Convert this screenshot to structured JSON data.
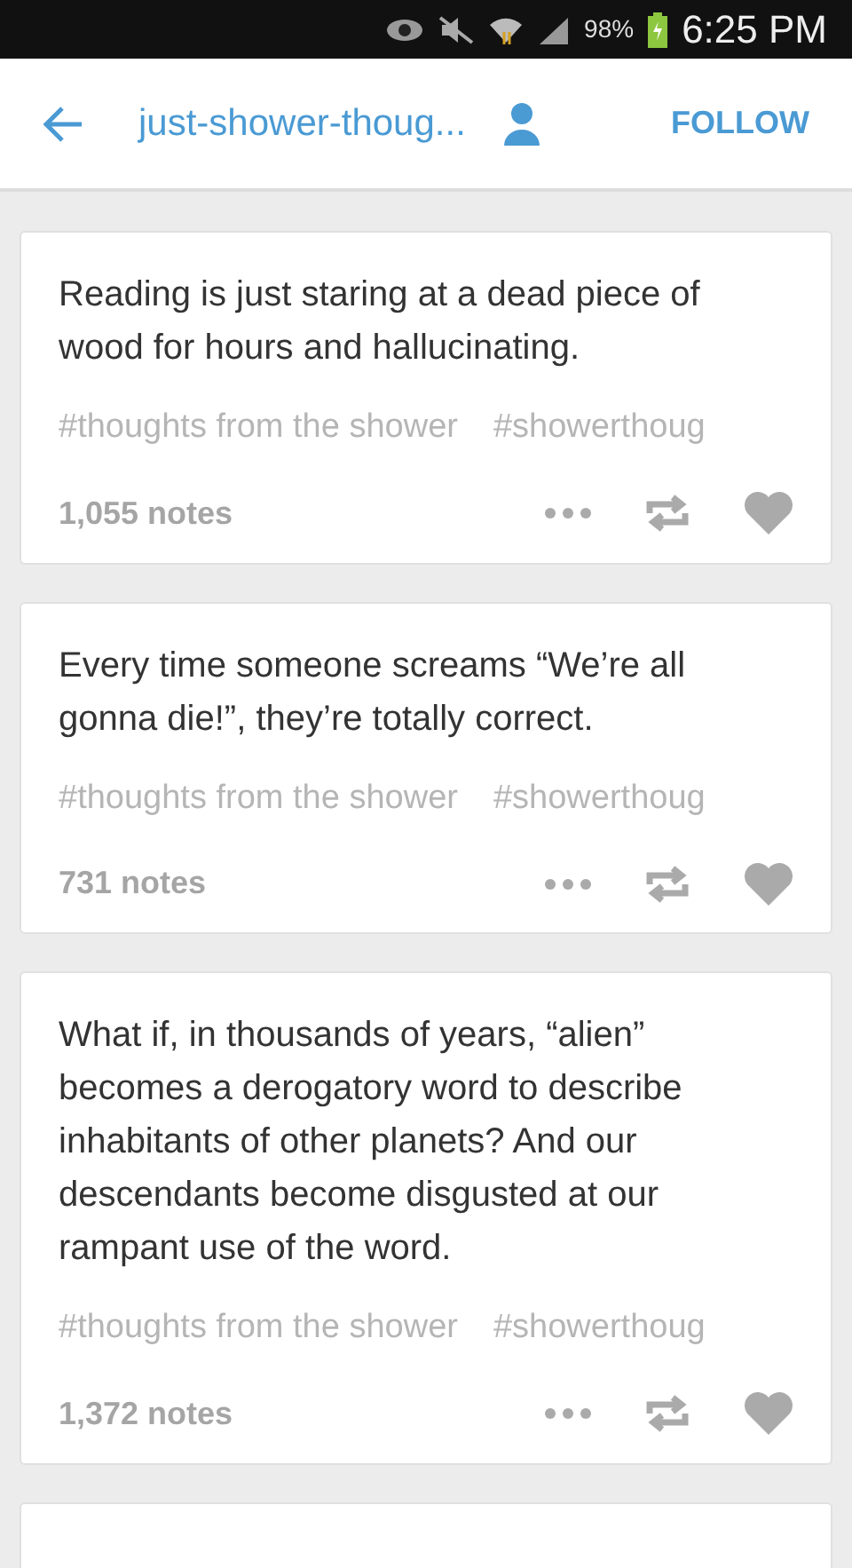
{
  "status_bar": {
    "battery": "98%",
    "time": "6:25 PM"
  },
  "header": {
    "title": "just-shower-thoug...",
    "follow": "FOLLOW"
  },
  "posts": [
    {
      "text": "Reading is just staring at a dead piece of wood for hours and hallucinating.",
      "tags": [
        "#thoughts from the shower",
        "#showerthoug"
      ],
      "notes": "1,055 notes"
    },
    {
      "text": "Every time someone screams “We’re all gonna die!”, they’re totally correct.",
      "tags": [
        "#thoughts from the shower",
        "#showerthoug"
      ],
      "notes": "731 notes"
    },
    {
      "text": "What if, in thousands of years, “alien” becomes a derogatory word to describe inhabitants of other planets? And our descendants become disgusted at our rampant use of the word.",
      "tags": [
        "#thoughts from the shower",
        "#showerthoug"
      ],
      "notes": "1,372 notes"
    }
  ]
}
